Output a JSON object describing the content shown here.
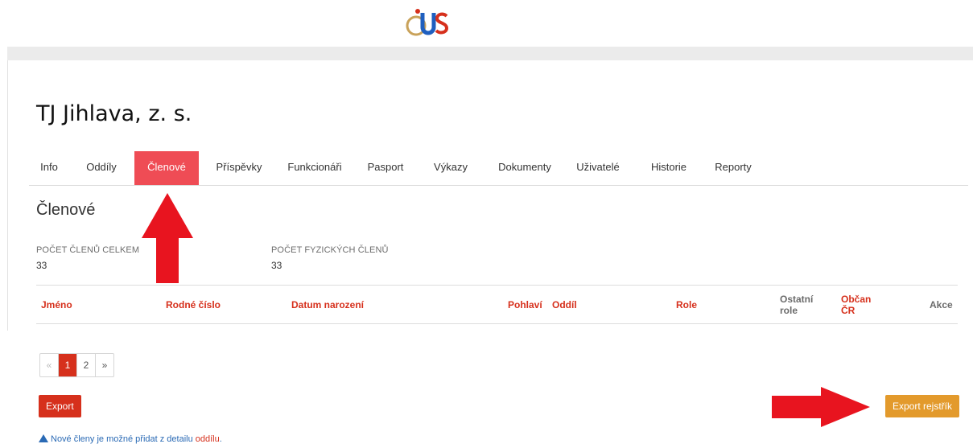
{
  "brand": {
    "logo_icon": "cus-logo-icon"
  },
  "header": {
    "title": "TJ Jihlava, z. s."
  },
  "tabs": [
    {
      "label": "Info"
    },
    {
      "label": "Oddíly"
    },
    {
      "label": "Členové",
      "active": true
    },
    {
      "label": "Příspěvky"
    },
    {
      "label": "Funkcionáři"
    },
    {
      "label": "Pasport"
    },
    {
      "label": "Výkazy"
    },
    {
      "label": "Dokumenty"
    },
    {
      "label": "Uživatelé"
    },
    {
      "label": "Historie"
    },
    {
      "label": "Reporty"
    }
  ],
  "section": {
    "title": "Členové"
  },
  "stats": [
    {
      "label": "POČET ČLENŮ CELKEM",
      "value": "33"
    },
    {
      "label": "POČET FYZICKÝCH ČLENŮ",
      "value": "33"
    }
  ],
  "table": {
    "headers": [
      "Jméno",
      "Rodné číslo",
      "Datum narození",
      "Pohlaví",
      "Oddíl",
      "Role",
      "Ostatní role",
      "Občan ČR",
      "Akce"
    ]
  },
  "pagination": {
    "prev": "«",
    "pages": [
      "1",
      "2"
    ],
    "next": "»",
    "current": "1"
  },
  "actions": {
    "export": "Export",
    "export_registry": "Export rejstřík"
  },
  "note": {
    "text": "Nové členy je možné přidat z detailu ",
    "link": "oddílu",
    "suffix": "."
  },
  "colors": {
    "accent": "#d6301c",
    "active_tab": "#ef4c55",
    "warning_button": "#e39a2c",
    "annotation_arrow": "#e8141f",
    "note_text": "#2a6ab5"
  }
}
